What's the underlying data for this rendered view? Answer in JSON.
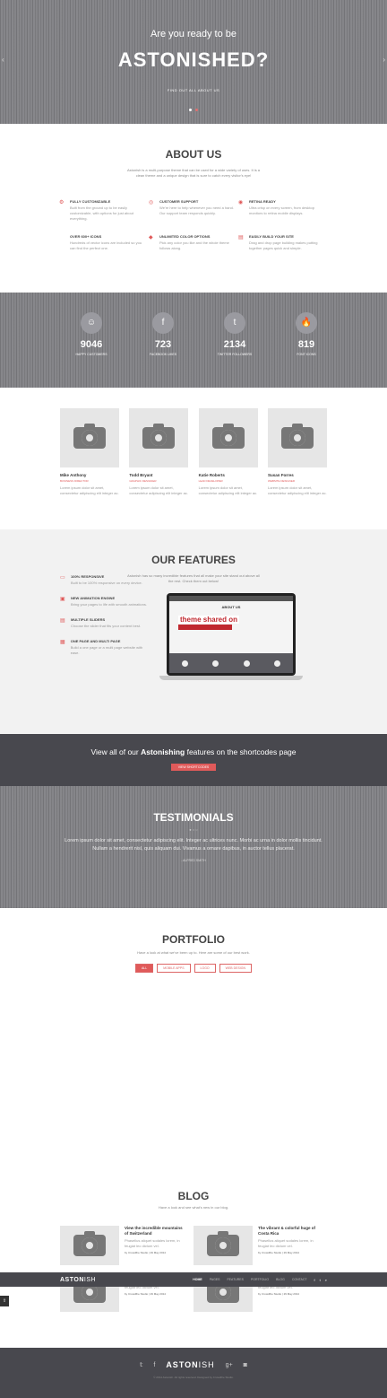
{
  "hero": {
    "pre": "Are you ready to be",
    "title": "ASTONISHED?",
    "link": "FIND OUT ALL ABOUT US"
  },
  "about": {
    "title": "ABOUT US",
    "intro": "Astonish is a multi-purpose theme that can be used for a wide variety of uses. It is a clean theme and a unique design that is sure to catch every visitor's eye!",
    "items": [
      {
        "title": "FULLY CUSTOMIZABLE",
        "text": "Built from the ground up to be easily customizable, with options for just about everything."
      },
      {
        "title": "CUSTOMER SUPPORT",
        "text": "We're here to help whenever you need a hand. Our support team responds quickly."
      },
      {
        "title": "RETINA READY",
        "text": "Ultra crisp on every screen, from desktop monitors to retina mobile displays."
      },
      {
        "title": "OVER 600+ ICONS",
        "text": "Hundreds of vector icons are included so you can find the perfect one."
      },
      {
        "title": "UNLIMITED COLOR OPTIONS",
        "text": "Pick any color you like and the whole theme follows along."
      },
      {
        "title": "EASILY BUILD YOUR SITE",
        "text": "Drag and drop page building makes putting together pages quick and simple."
      }
    ]
  },
  "stats": [
    {
      "value": "9046",
      "label": "HAPPY CUSTOMERS",
      "icon": "users-icon"
    },
    {
      "value": "723",
      "label": "FACEBOOK LIKES",
      "icon": "facebook-icon"
    },
    {
      "value": "2134",
      "label": "TWITTER FOLLOWERS",
      "icon": "twitter-icon"
    },
    {
      "value": "819",
      "label": "FONT ICONS",
      "icon": "fire-icon"
    }
  ],
  "team": [
    {
      "name": "Mike Anthony",
      "role": "BUSINESS DIRECTOR",
      "bio": "Lorem ipsum dolor sit amet, consectetur adipiscing elit integer ac."
    },
    {
      "name": "Todd Bryant",
      "role": "GRAPHIC DESIGNER",
      "bio": "Lorem ipsum dolor sit amet, consectetur adipiscing elit integer ac."
    },
    {
      "name": "Katie Roberts",
      "role": "LEAD DEVELOPER",
      "bio": "Lorem ipsum dolor sit amet, consectetur adipiscing elit integer ac."
    },
    {
      "name": "Susan Forres",
      "role": "WEBSITE DESIGNER",
      "bio": "Lorem ipsum dolor sit amet, consectetur adipiscing elit integer ac."
    }
  ],
  "features": {
    "title": "OUR FEATURES",
    "intro": "Astonish has so many incredible features that all make your site stand out above all the rest. Check them out below!",
    "items": [
      {
        "title": "100% RESPONSIVE",
        "text": "Built to be 100% responsive on every device."
      },
      {
        "title": "NEW ANIMATION ENGINE",
        "text": "Bring your pages to life with smooth animations."
      },
      {
        "title": "MULTIPLE SLIDERS",
        "text": "Choose the slider that fits your content best."
      },
      {
        "title": "ONE PAGE AND MULTI PAGE",
        "text": "Build a one page or a multi page website with ease."
      }
    ],
    "screen_title": "ABOUT US",
    "screen_overlay": "theme shared on"
  },
  "cta": {
    "before": "View all of our ",
    "bold": "Astonishing",
    "after": " features on the shortcodes page",
    "button": "VIEW SHORTCODES"
  },
  "testimonials": {
    "title": "TESTIMONIALS",
    "quote": "Lorem ipsum dolor sit amet, consectetur adipiscing elit. Integer ac ultrices nunc. Morbi ac urna in dolor mollis tincidunt. Nullam a hendrerit nisl, quis aliquam dui. Vivamus a ornare dapibus, in auctor tellus placerat.",
    "author": "- ALFRED SMITH"
  },
  "portfolio": {
    "title": "PORTFOLIO",
    "intro": "Have a look at what we've been up to. Here are some of our best work.",
    "filters": [
      "ALL",
      "MOBILE APPS",
      "LOGO",
      "WEB DESIGN"
    ]
  },
  "blog": {
    "title": "BLOG",
    "intro": "Have a look and see what's new in our blog.",
    "posts": [
      {
        "title": "View the incredible mountains of Switzerland",
        "text": "Phasellus aliquet sodales lorem, in feugiat leo dictum vel.",
        "meta": "by Crowdfire Studio | 29 May 2014"
      },
      {
        "title": "The vibrant & colorful huge of Costa Rica",
        "text": "Phasellus aliquet sodales lorem, in feugiat leo dictum vel.",
        "meta": "by Crowdfire Studio | 29 May 2014"
      },
      {
        "title": "adventure to China",
        "text": "Phasellus aliquet sodales lorem, in feugiat leo dictum vel.",
        "meta": "by Crowdfire Studio | 29 May 2014"
      },
      {
        "title": "style",
        "text": "Phasellus aliquet sodales lorem, in feugiat leo dictum vel.",
        "meta": "by Crowdfire Studio | 29 May 2014"
      }
    ]
  },
  "navbar": {
    "logo_bold": "ASTON",
    "logo_light": "ISH",
    "items": [
      "HOME",
      "PAGES",
      "FEATURES",
      "PORTFOLIO",
      "BLOG",
      "CONTACT"
    ]
  },
  "footer": {
    "logo_bold": "ASTON",
    "logo_light": "ISH",
    "copyright": "© 2014 Astonish. All rights reserved. Designed by Crowdfire Studio.",
    "social": [
      "twitter-icon",
      "facebook-icon",
      "google-plus-icon",
      "instagram-icon"
    ]
  },
  "colors": {
    "accent": "#e05a5a",
    "dark": "#48484e",
    "stripe": "#818185"
  }
}
